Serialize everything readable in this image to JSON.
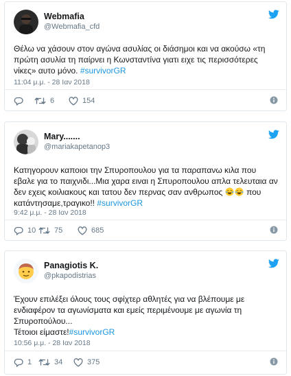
{
  "colors": {
    "accent": "#1da1f2",
    "hashtag": "#1b95e0",
    "text": "#14171a",
    "muted": "#657786",
    "border": "#e1e8ed"
  },
  "tweets": [
    {
      "display_name": "Webmafia",
      "handle": "@Webmafia_cfd",
      "text_before": "Θέλω να χάσουν στον αγώνα ασυλίας οι διάσημοι και να ακούσω «τη πρώτη ασυλία τη παίρνει η Κωνσταντίνα γιατι ειχε τις περισσότερες νίκες» αυτο μόνο. ",
      "hashtag": "#survivorGR",
      "date": "11:04 μ.μ. - 28 Ιαν 2018",
      "replies": "",
      "retweets": "6",
      "likes": "154",
      "icons": {
        "avatar": "avatar-dark",
        "brand": "twitter-bird-icon"
      }
    },
    {
      "display_name": "Mary.......",
      "handle": "@mariakapetanop3",
      "text_before": "Κατηγορουν καποιοι την Σπυροπουλου για τα παραπανω κιλα που εβαλε για το παιχνιδι...Μια χαρα ειναι η Σπυροπουλου απλα τελευταια αν δεν εχεις κοιλιακους και τατου δεν περνας σαν ανθρωπος ",
      "text_after": " που κατάντησαμε,τραγικο!! ",
      "hashtag": "#survivorGR",
      "emoji": "😂😂",
      "date": "9:42 μ.μ. - 28 Ιαν 2018",
      "replies": "10",
      "retweets": "75",
      "likes": "685",
      "icons": {
        "avatar": "avatar-photo",
        "brand": "twitter-bird-icon"
      }
    },
    {
      "display_name": "Panagiotis K.",
      "handle": "@pkapodistrias",
      "text_before": "Έχουν επιλέξει όλους τους σφίχτερ αθλητές για να βλέπουμε με ενδιαφέρον τα αγωνίσματα και εμείς περιμένουμε με αγωνία τη Σπυροπούλου...",
      "text_line2": "Τέτοιοι είμαστε!",
      "hashtag": "#survivorGR",
      "date": "10:56 μ.μ. - 28 Ιαν 2018",
      "replies": "1",
      "retweets": "34",
      "likes": "375",
      "icons": {
        "avatar": "avatar-emoji",
        "brand": "twitter-bird-icon"
      }
    }
  ]
}
